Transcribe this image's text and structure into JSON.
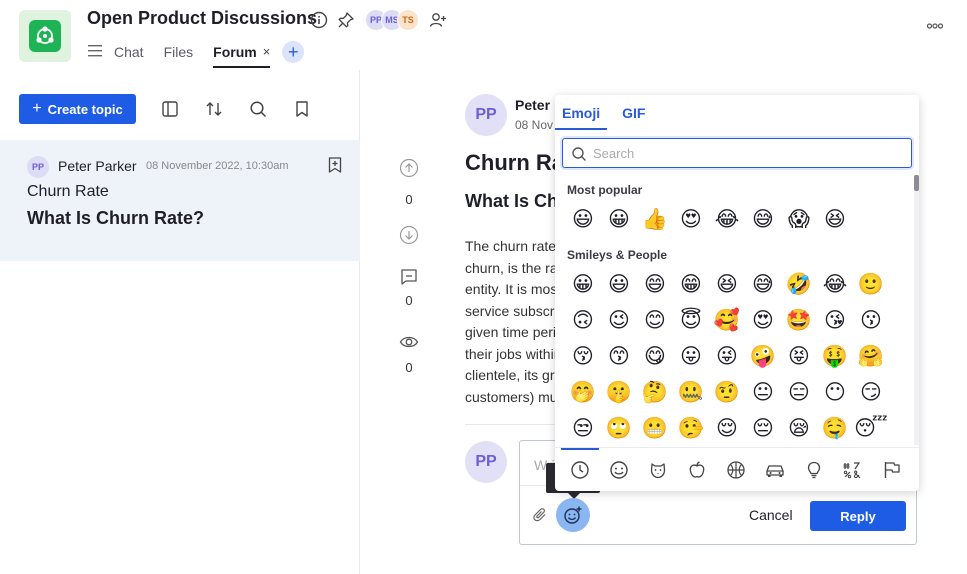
{
  "header": {
    "title": "Open Product Discussions",
    "avatars": [
      {
        "initials": "PP",
        "bg": "#dcdcf5",
        "fg": "#6b5fd6"
      },
      {
        "initials": "MS",
        "bg": "#dcdcf5",
        "fg": "#6b5fd6"
      },
      {
        "initials": "TS",
        "bg": "#fde3c9",
        "fg": "#c66a1a"
      }
    ],
    "tabs": [
      {
        "label": "Chat"
      },
      {
        "label": "Files"
      },
      {
        "label": "Forum",
        "close": "×"
      }
    ],
    "add_tab": "+",
    "more": "ooo"
  },
  "sidebar": {
    "create_label": "Create topic",
    "create_plus": "+",
    "topic": {
      "initials": "PP",
      "author": "Peter Parker",
      "date": "08 November 2022, 10:30am",
      "title": "Churn Rate",
      "subtitle": "What Is Churn Rate?"
    }
  },
  "post": {
    "initials": "PP",
    "author": "Peter",
    "date": "08 Nov",
    "title": "Churn Rate",
    "heading": "What Is Churn Rate?",
    "body_lines": [
      "The churn rate, also known as the rate of attrition or customer",
      "churn, is the rate at which customers stop doing business with an",
      "entity. It is most commonly expressed as the percentage of",
      "service subscribers who discontinue their subscriptions within a",
      "given time period. It is also the rate at which employees leave",
      "their jobs within a certain period. For a company to expand its",
      "clientele, its growth rate (measured by the number of new",
      "customers) must exceed its churn rate."
    ],
    "upvotes": "0",
    "comments": "0",
    "views": "0"
  },
  "reply": {
    "initials": "PP",
    "placeholder": "Write a reply...",
    "cancel": "Cancel",
    "submit": "Reply"
  },
  "emoji_picker": {
    "tabs": [
      "Emoji",
      "GIF"
    ],
    "search_placeholder": "Search",
    "sections": [
      {
        "title": "Most popular",
        "rows": [
          [
            "😃",
            "😀",
            "👍",
            "😍",
            "😂",
            "😅",
            "😱",
            "😆"
          ]
        ]
      },
      {
        "title": "Smileys & People",
        "rows": [
          [
            "😀",
            "😃",
            "😄",
            "😁",
            "😆",
            "😅",
            "🤣",
            "😂",
            "🙂"
          ],
          [
            "🙃",
            "😉",
            "😊",
            "😇",
            "🥰",
            "😍",
            "🤩",
            "😘",
            "😗"
          ],
          [
            "😚",
            "😙",
            "😋",
            "😛",
            "😜",
            "🤪",
            "😝",
            "🤑",
            "🤗"
          ],
          [
            "🤭",
            "🤫",
            "🤔",
            "🤐",
            "🤨",
            "😐",
            "😑",
            "😶",
            "😏"
          ],
          [
            "😒",
            "🙄",
            "😬",
            "🤥",
            "😌",
            "😔",
            "😪",
            "🤤",
            "😴"
          ]
        ]
      }
    ],
    "categories": [
      "recent",
      "smileys",
      "animals",
      "food",
      "activity",
      "travel",
      "objects",
      "symbols",
      "flags"
    ]
  },
  "colors": {
    "accent": "#1f5ce6",
    "logo": "#1eb455"
  }
}
